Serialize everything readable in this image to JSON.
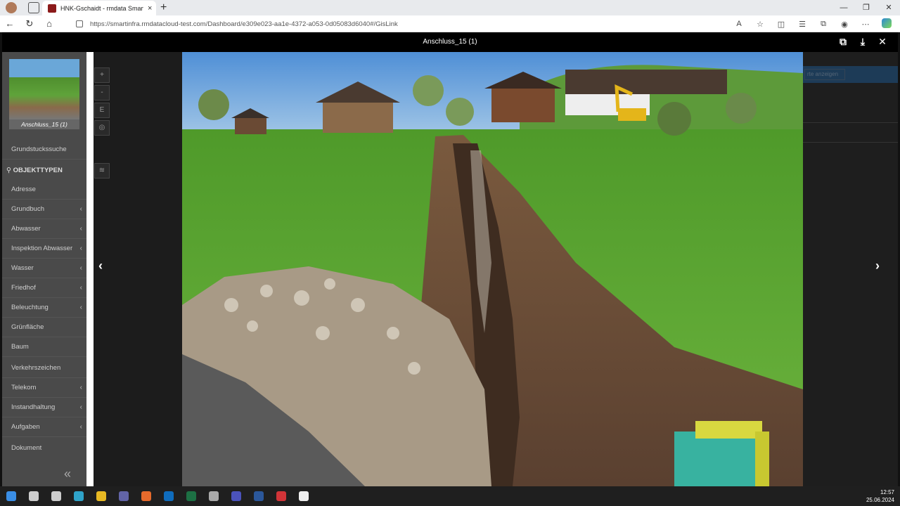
{
  "browser": {
    "tab_title": "HNK-Gschaidt - rmdata Smart In",
    "tab_close": "×",
    "new_tab": "+",
    "url": "https://smartinfra.rmdatacloud-test.com/Dashboard/e309e023-aa1e-4372-a053-0d05083d6040#/GisLink",
    "win_min": "—",
    "win_restore": "❐",
    "win_close": "✕"
  },
  "viewer": {
    "title": "Anschluss_15 (1)",
    "thumb_caption": "Anschluss_15 (1)",
    "prev_arrow": "‹",
    "next_arrow": "›",
    "open_icon": "⧉",
    "download_icon": "⤓",
    "close_icon": "✕"
  },
  "sidebar": {
    "section_objekttypen": "OBJEKTTYPEN",
    "items": [
      {
        "label": "Grundstuckssuche",
        "chevron": ""
      },
      {
        "label": "Adresse",
        "chevron": ""
      },
      {
        "label": "Grundbuch",
        "chevron": "‹"
      },
      {
        "label": "Abwasser",
        "chevron": "‹"
      },
      {
        "label": "Inspektion Abwasser",
        "chevron": "‹"
      },
      {
        "label": "Wasser",
        "chevron": "‹"
      },
      {
        "label": "Friedhof",
        "chevron": "‹"
      },
      {
        "label": "Beleuchtung",
        "chevron": "‹"
      },
      {
        "label": "Grünfläche",
        "chevron": ""
      },
      {
        "label": "Baum",
        "chevron": ""
      },
      {
        "label": "Verkehrszeichen",
        "chevron": ""
      },
      {
        "label": "Telekom",
        "chevron": "‹"
      },
      {
        "label": "Instandhaltung",
        "chevron": "‹"
      },
      {
        "label": "Aufgaben",
        "chevron": "‹"
      },
      {
        "label": "Dokument",
        "chevron": ""
      }
    ],
    "collapse": "«"
  },
  "map_tools": [
    "+",
    "-",
    "E",
    "◎",
    "≋"
  ],
  "right_panel": {
    "button_label": "rte anzeigen"
  },
  "taskbar": {
    "time": "12:57",
    "date": "25.06.2024",
    "icons": [
      {
        "name": "start",
        "color": "#3a8ee6"
      },
      {
        "name": "search",
        "color": "#cccccc"
      },
      {
        "name": "taskview",
        "color": "#cccccc"
      },
      {
        "name": "edge",
        "color": "#2fa3c9"
      },
      {
        "name": "explorer",
        "color": "#e8b923"
      },
      {
        "name": "teams",
        "color": "#6264a7"
      },
      {
        "name": "firefox",
        "color": "#e66a2c"
      },
      {
        "name": "outlook",
        "color": "#0f6cbd"
      },
      {
        "name": "excel",
        "color": "#1d7044"
      },
      {
        "name": "app-gear",
        "color": "#aaaaaa"
      },
      {
        "name": "teams-classic",
        "color": "#4b53bc"
      },
      {
        "name": "word",
        "color": "#2b579a"
      },
      {
        "name": "recorder",
        "color": "#d13438"
      },
      {
        "name": "media",
        "color": "#eeeeee"
      }
    ]
  }
}
